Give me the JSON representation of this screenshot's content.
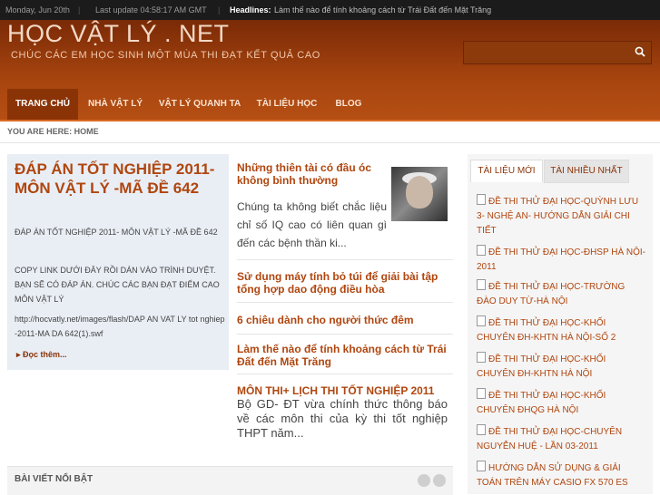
{
  "topbar": {
    "date": "Monday, Jun 20th",
    "last_update": "Last update 04:58:17 AM GMT",
    "headlines_label": "Headlines:",
    "ticker": "Làm thế nào để tính khoảng cách từ Trái Đất đến Mặt Trăng"
  },
  "header": {
    "site_title": "HỌC VẬT LÝ . NET",
    "tagline": "CHÚC CÁC EM HỌC SINH MỘT MÙA THI ĐẠT KẾT QUẢ CAO",
    "search_value": ""
  },
  "nav": {
    "items": [
      {
        "label": "TRANG CHỦ"
      },
      {
        "label": "NHÀ VẬT LÝ"
      },
      {
        "label": "VẬT LÝ QUANH TA"
      },
      {
        "label": "TÀI LIỆU HỌC"
      },
      {
        "label": "BLOG"
      }
    ]
  },
  "breadcrumb": "YOU ARE HERE: HOME",
  "feature": {
    "title": "ĐÁP ÁN TỐT NGHIỆP 2011- MÔN VẬT LÝ -MÃ ĐỀ 642",
    "p1": "ĐÁP ÁN TỐT NGHIỆP 2011- MÔN VẬT LÝ -MÃ ĐỀ 642",
    "p2": "COPY LINK DƯỚI ĐÂY RỒI DÁN VÀO TRÌNH DUYỆT. BẠN SẼ CÓ ĐÁP ÁN. CHÚC CÁC BẠN ĐẠT ĐIỂM CAO MÔN VẬT LÝ",
    "p3": "http://hocvatly.net/images/flash/DAP AN VAT LY tot nghiep -2011-MA DA 642(1).swf",
    "more": "Đọc thêm..."
  },
  "articles": [
    {
      "title": "Những thiên tài có đầu óc không bình thường",
      "excerpt": "Chúng ta không biết chắc liệu chỉ số IQ cao có liên quan gì đến các bệnh thần ki..."
    },
    {
      "title": "Sử dụng máy tính bỏ túi để giải bài tập tổng hợp dao động điều hòa"
    },
    {
      "title": "6 chiêu dành cho người thức đêm"
    },
    {
      "title": "Làm thế nào để tính khoảng cách từ Trái Đất đến Mặt Trăng"
    },
    {
      "title": "MÔN THI+ LỊCH THI TỐT NGHIỆP 2011",
      "excerpt": "Bộ GD- ĐT vừa chính thức thông báo về các môn thi của kỳ thi tốt nghiệp THPT năm..."
    }
  ],
  "featured_box": {
    "title": "BÀI VIẾT NỔI BẬT"
  },
  "sidebar": {
    "tabs": [
      {
        "label": "TÀI LIỆU MỚI"
      },
      {
        "label": "TÀI NHIỀU NHẤT"
      }
    ],
    "items": [
      {
        "label": "ĐỀ THI THỬ ĐẠI HỌC-QUỲNH LƯU 3- NGHỆ AN- HƯỚNG DẪN GIẢI CHI TIẾT"
      },
      {
        "label": "ĐỀ THI THỬ ĐẠI HỌC-ĐHSP HÀ NỘI-2011"
      },
      {
        "label": "ĐỀ THI THỬ ĐẠI HỌC-TRƯỜNG ĐÀO DUY TỪ-HÀ NỘI"
      },
      {
        "label": "ĐỀ THI THỬ ĐẠI HỌC-KHỐI CHUYÊN ĐH-KHTN HÀ NỘI-SỐ 2"
      },
      {
        "label": "ĐỀ THI THỬ ĐẠI HỌC-KHỐI CHUYÊN ĐH-KHTN HÀ NỘI"
      },
      {
        "label": "ĐỀ THI THỬ ĐẠI HỌC-KHỐI CHUYÊN ĐHQG HÀ NỘI"
      },
      {
        "label": "ĐỀ THI THỬ ĐẠI HỌC-CHUYÊN NGUYỄN HUỆ - LẦN 03-2011"
      },
      {
        "label": "HƯỚNG DẪN SỬ DỤNG & GIẢI TOÁN TRÊN MÁY CASIO FX 570 ES"
      }
    ]
  }
}
